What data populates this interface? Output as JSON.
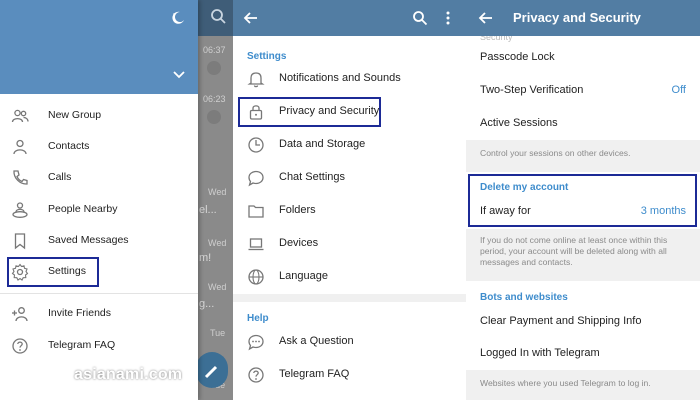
{
  "drawer": {
    "items": [
      {
        "label": "New Group",
        "icon": "people-icon"
      },
      {
        "label": "Contacts",
        "icon": "person-icon"
      },
      {
        "label": "Calls",
        "icon": "phone-icon"
      },
      {
        "label": "People Nearby",
        "icon": "people-nearby-icon"
      },
      {
        "label": "Saved Messages",
        "icon": "bookmark-icon"
      },
      {
        "label": "Settings",
        "icon": "gear-icon"
      },
      {
        "label": "Invite Friends",
        "icon": "add-person-icon"
      },
      {
        "label": "Telegram FAQ",
        "icon": "help-icon"
      }
    ]
  },
  "chat_list": {
    "times": [
      "06:37",
      "06:23",
      "Wed",
      "Wed",
      "Wed",
      "Tue",
      "Tue"
    ],
    "snippets": [
      "el...",
      "m!",
      "g..."
    ]
  },
  "settings": {
    "section_settings": "Settings",
    "items": [
      {
        "label": "Notifications and Sounds",
        "icon": "bell-icon"
      },
      {
        "label": "Privacy and Security",
        "icon": "lock-icon"
      },
      {
        "label": "Data and Storage",
        "icon": "clock-icon"
      },
      {
        "label": "Chat Settings",
        "icon": "chat-bubble-icon"
      },
      {
        "label": "Folders",
        "icon": "folder-icon"
      },
      {
        "label": "Devices",
        "icon": "laptop-icon"
      },
      {
        "label": "Language",
        "icon": "globe-icon"
      }
    ],
    "section_help": "Help",
    "help_items": [
      {
        "label": "Ask a Question",
        "icon": "speech-dots-icon"
      },
      {
        "label": "Telegram FAQ",
        "icon": "help-icon"
      }
    ]
  },
  "privacy": {
    "title": "Privacy and Security",
    "cut_text": "Security",
    "passcode_lock": "Passcode Lock",
    "two_step": "Two-Step Verification",
    "two_step_value": "Off",
    "active_sessions": "Active Sessions",
    "sessions_note": "Control your sessions on other devices.",
    "delete_section": "Delete my account",
    "if_away": "If away for",
    "if_away_value": "3 months",
    "delete_note": "If you do not come online at least once within this period, your account will be deleted along with all messages and contacts.",
    "bots_section": "Bots and websites",
    "clear_payment": "Clear Payment and Shipping Info",
    "logged_in": "Logged In with Telegram",
    "websites_note": "Websites where you used Telegram to log in."
  },
  "watermark": "asianami.com",
  "colors": {
    "header_blue": "#527da3",
    "drawer_header": "#5a8dbe",
    "accent": "#3e8ccc",
    "highlight_border": "#1c2a96"
  }
}
